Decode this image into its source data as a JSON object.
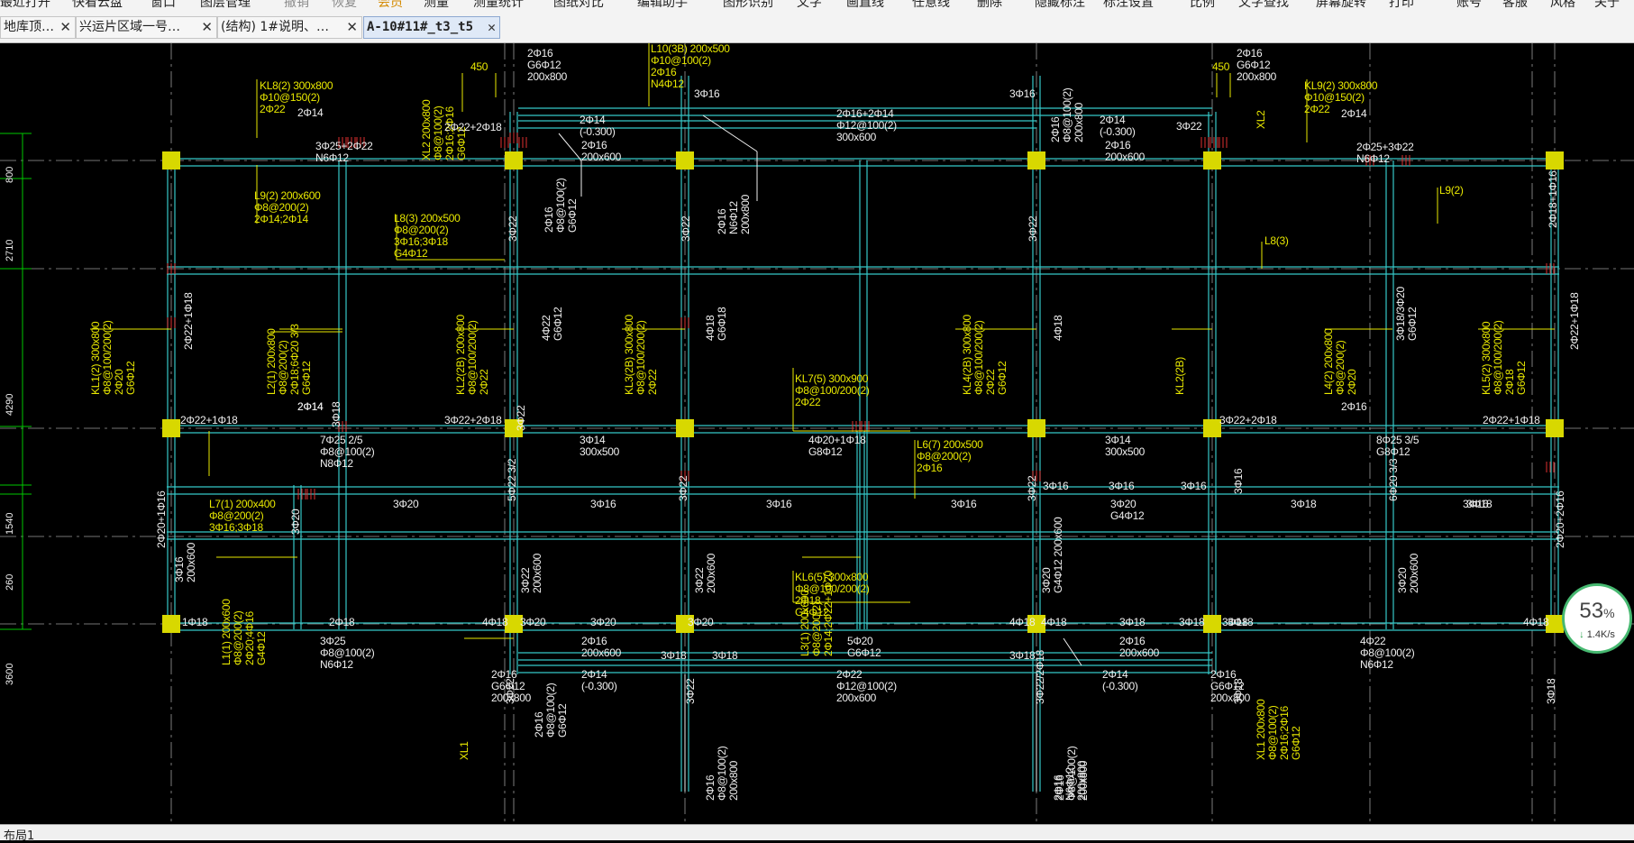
{
  "menu": {
    "items": [
      {
        "label": "最近打开",
        "state": "normal"
      },
      {
        "label": "快看云盘",
        "state": "normal"
      },
      {
        "label": "窗口",
        "state": "normal"
      },
      {
        "label": "图层管理",
        "state": "normal"
      },
      {
        "label": "撤销",
        "state": "dim"
      },
      {
        "label": "恢复",
        "state": "dim"
      },
      {
        "label": "会员",
        "state": "active"
      },
      {
        "label": "测量",
        "state": "normal"
      },
      {
        "label": "测量统计",
        "state": "normal"
      },
      {
        "label": "图纸对比",
        "state": "normal"
      },
      {
        "label": "编辑助手",
        "state": "normal"
      },
      {
        "label": "图形识别",
        "state": "normal"
      },
      {
        "label": "文字",
        "state": "normal"
      },
      {
        "label": "画直线",
        "state": "normal"
      },
      {
        "label": "任意线",
        "state": "normal"
      },
      {
        "label": "删除",
        "state": "normal"
      },
      {
        "label": "隐藏标注",
        "state": "normal"
      },
      {
        "label": "标注设置",
        "state": "normal"
      },
      {
        "label": "比例",
        "state": "normal"
      },
      {
        "label": "文字查找",
        "state": "normal"
      },
      {
        "label": "屏幕旋转",
        "state": "normal"
      },
      {
        "label": "打印",
        "state": "normal"
      },
      {
        "label": "账号",
        "state": "normal"
      },
      {
        "label": "客服",
        "state": "normal"
      },
      {
        "label": "风格",
        "state": "normal"
      },
      {
        "label": "关于",
        "state": "normal"
      }
    ]
  },
  "tabs": [
    {
      "label": "地库顶…",
      "close": "✕",
      "active": false
    },
    {
      "label": "兴运片区域一号…",
      "close": "✕",
      "active": false
    },
    {
      "label": "(结构) 1#说明、…",
      "close": "✕",
      "active": false
    },
    {
      "label": "A-10#11#_t3_t5",
      "close": "✕",
      "active": true
    }
  ],
  "colors": {
    "background": "#000000",
    "beam": "#35c8c8",
    "column": "#d8d800",
    "annotation": "#e8e800",
    "text": "#f0f0f0",
    "axis": "#c8c8c8",
    "rebar": "#e03030",
    "dimension": "#00c800",
    "progress_ring": "#46b870"
  },
  "dimensions": [
    {
      "label": "800"
    },
    {
      "label": "2710"
    },
    {
      "label": "4290"
    },
    {
      "label": "1540"
    },
    {
      "label": "260"
    },
    {
      "label": "3600"
    }
  ],
  "drawing": {
    "yellow_labels": [
      {
        "text": "KL8(2) 300x800\nΦ10@150(2)\n2Φ22"
      },
      {
        "text": "L9(2) 200x600\nΦ8@200(2)\n2Φ14;2Φ14"
      },
      {
        "text": "L8(3) 200x500\nΦ8@200(2)\n3Φ16;3Φ18\nG4Φ12"
      },
      {
        "text": "L7(1) 200x400\nΦ8@200(2)\n3Φ16;3Φ18"
      },
      {
        "text": "KL7(5) 300x900\nΦ8@100/200(2)\n2Φ22"
      },
      {
        "text": "L6(7) 200x500\nΦ8@200(2)\n2Φ16"
      },
      {
        "text": "KL6(5) 300x800\nΦ8@100/200(2)\n2Φ18\nG4Φ12"
      },
      {
        "text": "KL9(2) 300x800\nΦ10@150(2)\n2Φ22"
      },
      {
        "text": "L9(2)"
      },
      {
        "text": "L8(3)"
      },
      {
        "text": "450"
      },
      {
        "text": "450"
      },
      {
        "text": "L10(3B) 200x500\nΦ10@100(2)\n2Φ16\nN4Φ12"
      }
    ],
    "yellow_vertical": [
      {
        "text": "XL2 200x800\nΦ8@100(2)\n2Φ16;2Φ16\nG6Φ12"
      },
      {
        "text": "KL1(2) 300x800\nΦ8@100/200(2)\n2Φ20\nG6Φ12"
      },
      {
        "text": "L2(1) 200x800\nΦ8@200(2)\n2Φ18;6Φ20 3/3\nG6Φ12"
      },
      {
        "text": "KL2(2B) 200x800\nΦ8@100/200(2)\n2Φ22"
      },
      {
        "text": "KL3(2B) 300x800\nΦ8@100/200(2)\n2Φ22"
      },
      {
        "text": "KL4(2B) 300x800\nΦ8@100/200(2)\n2Φ22\nG6Φ12"
      },
      {
        "text": "KL2(2B)"
      },
      {
        "text": "L4(2) 200x800\nΦ8@200(2)\n2Φ20"
      },
      {
        "text": "KL5(2) 300x800\nΦ8@100/200(2)\n2Φ18\nG6Φ12"
      },
      {
        "text": "L1(1) 200x600\nΦ8@200(2)\n2Φ20;4Φ16\nG4Φ12"
      },
      {
        "text": "L3(1) 200x600\nΦ8@200(2)\n2Φ14;2Φ22+1Φ20"
      },
      {
        "text": "XL1"
      },
      {
        "text": "XL2"
      },
      {
        "text": "XL1 200x800\nΦ8@100(2)\n2Φ16;2Φ16\nG6Φ12"
      }
    ],
    "white_labels": [
      {
        "text": "2Φ16\nG6Φ12\n200x800"
      },
      {
        "text": "2Φ14"
      },
      {
        "text": "2Φ22+2Φ18"
      },
      {
        "text": "3Φ25+2Φ22\nN6Φ12"
      },
      {
        "text": "2Φ14\n(-0.300)"
      },
      {
        "text": "2Φ16\n200x600"
      },
      {
        "text": "3Φ16"
      },
      {
        "text": "2Φ16+2Φ14\nΦ12@100(2)\n300x600"
      },
      {
        "text": "3Φ16"
      },
      {
        "text": "2Φ14\n(-0.300)"
      },
      {
        "text": "3Φ22"
      },
      {
        "text": "2Φ16\n200x600"
      },
      {
        "text": "2Φ16\nG6Φ12\n200x800"
      },
      {
        "text": "2Φ14"
      },
      {
        "text": "2Φ25+3Φ22\nN6Φ12"
      },
      {
        "text": "2Φ14"
      },
      {
        "text": "2Φ22+1Φ18"
      },
      {
        "text": "7Φ25 2/5\nΦ8@100(2)\nN8Φ12"
      },
      {
        "text": "3Φ22+2Φ18"
      },
      {
        "text": "3Φ14\n300x500"
      },
      {
        "text": "4Φ20+1Φ18\nG8Φ12"
      },
      {
        "text": "3Φ14\n300x500"
      },
      {
        "text": "3Φ22+2Φ18"
      },
      {
        "text": "2Φ16"
      },
      {
        "text": "8Φ25 3/5\nG8Φ12"
      },
      {
        "text": "2Φ22+1Φ18"
      },
      {
        "text": "3Φ20"
      },
      {
        "text": "3Φ16"
      },
      {
        "text": "3Φ16"
      },
      {
        "text": "3Φ16"
      },
      {
        "text": "3Φ16"
      },
      {
        "text": "3Φ16"
      },
      {
        "text": "3Φ20\nG4Φ12"
      },
      {
        "text": "3Φ16"
      },
      {
        "text": "3Φ18"
      },
      {
        "text": "3Φ16"
      },
      {
        "text": "3Φ18"
      },
      {
        "text": "2Φ18"
      },
      {
        "text": "4Φ18"
      },
      {
        "text": "3Φ20"
      },
      {
        "text": "3Φ20"
      },
      {
        "text": "3Φ20"
      },
      {
        "text": "4Φ18"
      },
      {
        "text": "4Φ18"
      },
      {
        "text": "3Φ18"
      },
      {
        "text": "3Φ18"
      },
      {
        "text": "3Φ18"
      },
      {
        "text": "3Φ18"
      },
      {
        "text": "4Φ18"
      },
      {
        "text": "3Φ25\nΦ8@100(2)\nN6Φ12"
      },
      {
        "text": "2Φ16\n200x600"
      },
      {
        "text": "3Φ18"
      },
      {
        "text": "3Φ18"
      },
      {
        "text": "5Φ20\nG6Φ12"
      },
      {
        "text": "3Φ18"
      },
      {
        "text": "2Φ16\n200x600"
      },
      {
        "text": "4Φ22\nΦ8@100(2)\nN6Φ12"
      },
      {
        "text": "2Φ16\nG6Φ12\n200x800"
      },
      {
        "text": "2Φ14\n(-0.300)"
      },
      {
        "text": "2Φ22\nΦ12@100(2)\n200x600"
      },
      {
        "text": "2Φ14\n(-0.300)"
      },
      {
        "text": "2Φ16\nG6Φ12\n200x800"
      },
      {
        "text": "1Φ18"
      },
      {
        "text": "2Φ14"
      }
    ],
    "white_vertical": [
      {
        "text": "2Φ16\nΦ8@100(2)\nG6Φ12"
      },
      {
        "text": "2Φ16\nN6Φ12\n200x800"
      },
      {
        "text": "2Φ16\nΦ8@100(2)\n200x800"
      },
      {
        "text": "3Φ22"
      },
      {
        "text": "3Φ22"
      },
      {
        "text": "3Φ22"
      },
      {
        "text": "2Φ18+1Φ16"
      },
      {
        "text": "2Φ22+1Φ18"
      },
      {
        "text": "2Φ22+1Φ18"
      },
      {
        "text": "4Φ22\nG6Φ12"
      },
      {
        "text": "4Φ18\nG6Φ18"
      },
      {
        "text": "4Φ18"
      },
      {
        "text": "3Φ18/3Φ20\nG6Φ12"
      },
      {
        "text": "2Φ20+2Φ16"
      },
      {
        "text": "2Φ20+1Φ16"
      },
      {
        "text": "5Φ22 3/2"
      },
      {
        "text": "3Φ22"
      },
      {
        "text": "3Φ22"
      },
      {
        "text": "6Φ20 3/3"
      },
      {
        "text": "3Φ22"
      },
      {
        "text": "3Φ18"
      },
      {
        "text": "3Φ20"
      },
      {
        "text": "3Φ16\n200x600"
      },
      {
        "text": "3Φ22\n200x600"
      },
      {
        "text": "3Φ22\n200x600"
      },
      {
        "text": "3Φ20\nG4Φ12 200x600"
      },
      {
        "text": "3Φ20\n200x600"
      },
      {
        "text": "3Φ22"
      },
      {
        "text": "3Φ22"
      },
      {
        "text": "3Φ22/2Φ18"
      },
      {
        "text": "3Φ18"
      },
      {
        "text": "2Φ16\nΦ8@100(2)\nG6Φ12"
      },
      {
        "text": "2Φ16\nΦ8@100(2)\n200x800"
      },
      {
        "text": "2Φ16\nΦ8@100(2)\n200x800"
      },
      {
        "text": "3Φ18"
      },
      {
        "text": "3Φ16"
      },
      {
        "text": "2Φ16\nN6Φ12\n200x800"
      }
    ]
  },
  "layout_tab": "布局1",
  "speed_widget": {
    "percent": "53",
    "percent_unit": "%",
    "rate": "1.4K/s",
    "arrow": "↓"
  }
}
